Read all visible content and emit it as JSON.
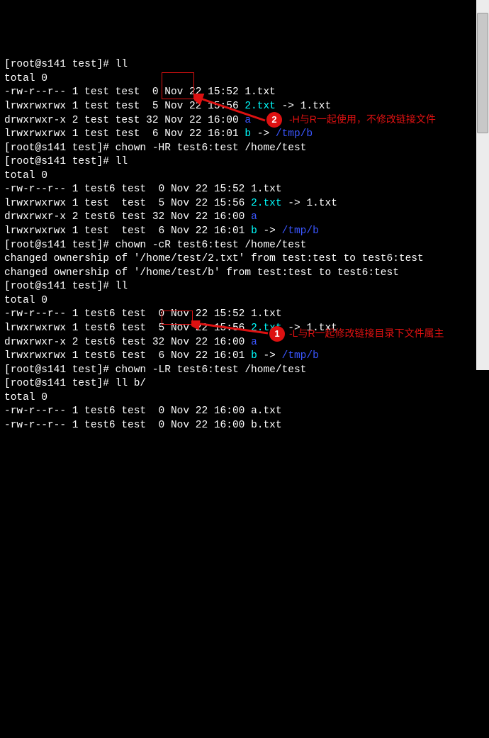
{
  "prompt": {
    "user_host": "root@s141",
    "dir": "test",
    "mark": "#"
  },
  "commands": {
    "ll": "ll",
    "chown_HR": "chown -HR test6:test /home/test",
    "chown_cR": "chown -cR test6:test /home/test",
    "chown_LR": "chown -LR test6:test /home/test",
    "ll_b": "ll b/"
  },
  "totals": {
    "zero": "total 0"
  },
  "listing1": [
    {
      "perm": "-rw-r--r--",
      "links": "1",
      "owner": "test",
      "group": "test",
      "size": "0",
      "date": "Nov 22 15:52",
      "name": "1.txt"
    },
    {
      "perm": "lrwxrwxrwx",
      "links": "1",
      "owner": "test",
      "group": "test",
      "size": "5",
      "date": "Nov 22 15:56",
      "name": "2.txt",
      "target": "1.txt",
      "name_color": "cyan"
    },
    {
      "perm": "drwxrwxr-x",
      "links": "2",
      "owner": "test",
      "group": "test",
      "size": "32",
      "date": "Nov 22 16:00",
      "name": "a",
      "name_color": "blue"
    },
    {
      "perm": "lrwxrwxrwx",
      "links": "1",
      "owner": "test",
      "group": "test",
      "size": "6",
      "date": "Nov 22 16:01",
      "name": "b",
      "target": "/tmp/b",
      "name_color": "cyan",
      "target_color": "blue"
    }
  ],
  "listing2": [
    {
      "perm": "-rw-r--r--",
      "links": "1",
      "owner": "test6",
      "group": "test",
      "size": "0",
      "date": "Nov 22 15:52",
      "name": "1.txt"
    },
    {
      "perm": "lrwxrwxrwx",
      "links": "1",
      "owner": "test ",
      "group": "test",
      "size": "5",
      "date": "Nov 22 15:56",
      "name": "2.txt",
      "target": "1.txt",
      "name_color": "cyan"
    },
    {
      "perm": "drwxrwxr-x",
      "links": "2",
      "owner": "test6",
      "group": "test",
      "size": "32",
      "date": "Nov 22 16:00",
      "name": "a",
      "name_color": "blue"
    },
    {
      "perm": "lrwxrwxrwx",
      "links": "1",
      "owner": "test ",
      "group": "test",
      "size": "6",
      "date": "Nov 22 16:01",
      "name": "b",
      "target": "/tmp/b",
      "name_color": "cyan",
      "target_color": "blue"
    }
  ],
  "changed": [
    "changed ownership of '/home/test/2.txt' from test:test to test6:test",
    "changed ownership of '/home/test/b' from test:test to test6:test"
  ],
  "listing3": [
    {
      "perm": "-rw-r--r--",
      "links": "1",
      "owner": "test6",
      "group": "test",
      "size": "0",
      "date": "Nov 22 15:52",
      "name": "1.txt"
    },
    {
      "perm": "lrwxrwxrwx",
      "links": "1",
      "owner": "test6",
      "group": "test",
      "size": "5",
      "date": "Nov 22 15:56",
      "name": "2.txt",
      "target": "1.txt",
      "name_color": "cyan"
    },
    {
      "perm": "drwxrwxr-x",
      "links": "2",
      "owner": "test6",
      "group": "test",
      "size": "32",
      "date": "Nov 22 16:00",
      "name": "a",
      "name_color": "blue"
    },
    {
      "perm": "lrwxrwxrwx",
      "links": "1",
      "owner": "test6",
      "group": "test",
      "size": "6",
      "date": "Nov 22 16:01",
      "name": "b",
      "target": "/tmp/b",
      "name_color": "cyan",
      "target_color": "blue"
    }
  ],
  "listing_b": [
    {
      "perm": "-rw-r--r--",
      "links": "1",
      "owner": "test6",
      "group": "test",
      "size": "0",
      "date": "Nov 22 16:00",
      "name": "a.txt"
    },
    {
      "perm": "-rw-r--r--",
      "links": "1",
      "owner": "test6",
      "group": "test",
      "size": "0",
      "date": "Nov 22 16:00",
      "name": "b.txt"
    }
  ],
  "callouts": {
    "c2_num": "2",
    "c2_text": "-H与R一起使用，不修改链接文件",
    "c1_num": "1",
    "c1_text": "-L与R一起修改链接目录下文件属主"
  },
  "arrow_label": "→"
}
